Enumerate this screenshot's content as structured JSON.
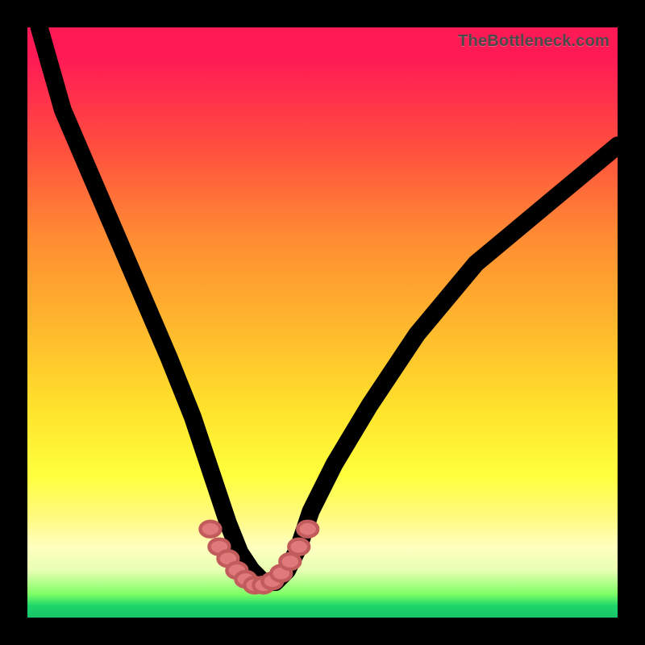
{
  "watermark": "TheBottleneck.com",
  "colors": {
    "frame": "#000000",
    "curve": "#000000",
    "bead_fill": "#e07a7a",
    "bead_stroke": "#c25b5b",
    "gradient_stops": [
      {
        "pct": 0,
        "hex": "#ff1a55"
      },
      {
        "pct": 5,
        "hex": "#ff1a55"
      },
      {
        "pct": 20,
        "hex": "#ff4d3f"
      },
      {
        "pct": 35,
        "hex": "#ff8a33"
      },
      {
        "pct": 50,
        "hex": "#ffb62d"
      },
      {
        "pct": 65,
        "hex": "#ffe32c"
      },
      {
        "pct": 76,
        "hex": "#ffff3d"
      },
      {
        "pct": 83,
        "hex": "#fffa80"
      },
      {
        "pct": 88,
        "hex": "#ffffbf"
      },
      {
        "pct": 92,
        "hex": "#e8ffb3"
      },
      {
        "pct": 96,
        "hex": "#7fff66"
      },
      {
        "pct": 98,
        "hex": "#1dd66a"
      },
      {
        "pct": 100,
        "hex": "#19c36a"
      }
    ]
  },
  "chart_data": {
    "type": "line",
    "title": "",
    "xlabel": "",
    "ylabel": "",
    "xlim": [
      0,
      100
    ],
    "ylim": [
      0,
      100
    ],
    "note": "No numeric axis ticks or labels are shown; x/y here are normalized 0–100 to plot-area width/height. Curve is a V / bottleneck shape with minimum near x≈36–42, y≈5.",
    "series": [
      {
        "name": "main-curve",
        "x": [
          2,
          6,
          12,
          18,
          24,
          28,
          30,
          32,
          34,
          36,
          38,
          40,
          42,
          44,
          46,
          48,
          52,
          58,
          66,
          76,
          88,
          100
        ],
        "y": [
          100,
          86,
          72,
          58,
          44,
          34,
          28,
          22,
          16,
          11,
          8,
          6,
          6,
          8,
          12,
          18,
          26,
          36,
          48,
          60,
          70,
          80
        ]
      },
      {
        "name": "bead-markers",
        "x": [
          31,
          32.5,
          34,
          35.5,
          37,
          38.5,
          40,
          41.5,
          43,
          44.5,
          46,
          47.5
        ],
        "y": [
          15,
          12,
          10,
          8,
          6.5,
          5.5,
          5.5,
          6.2,
          7.5,
          9.5,
          12,
          15
        ]
      }
    ]
  }
}
